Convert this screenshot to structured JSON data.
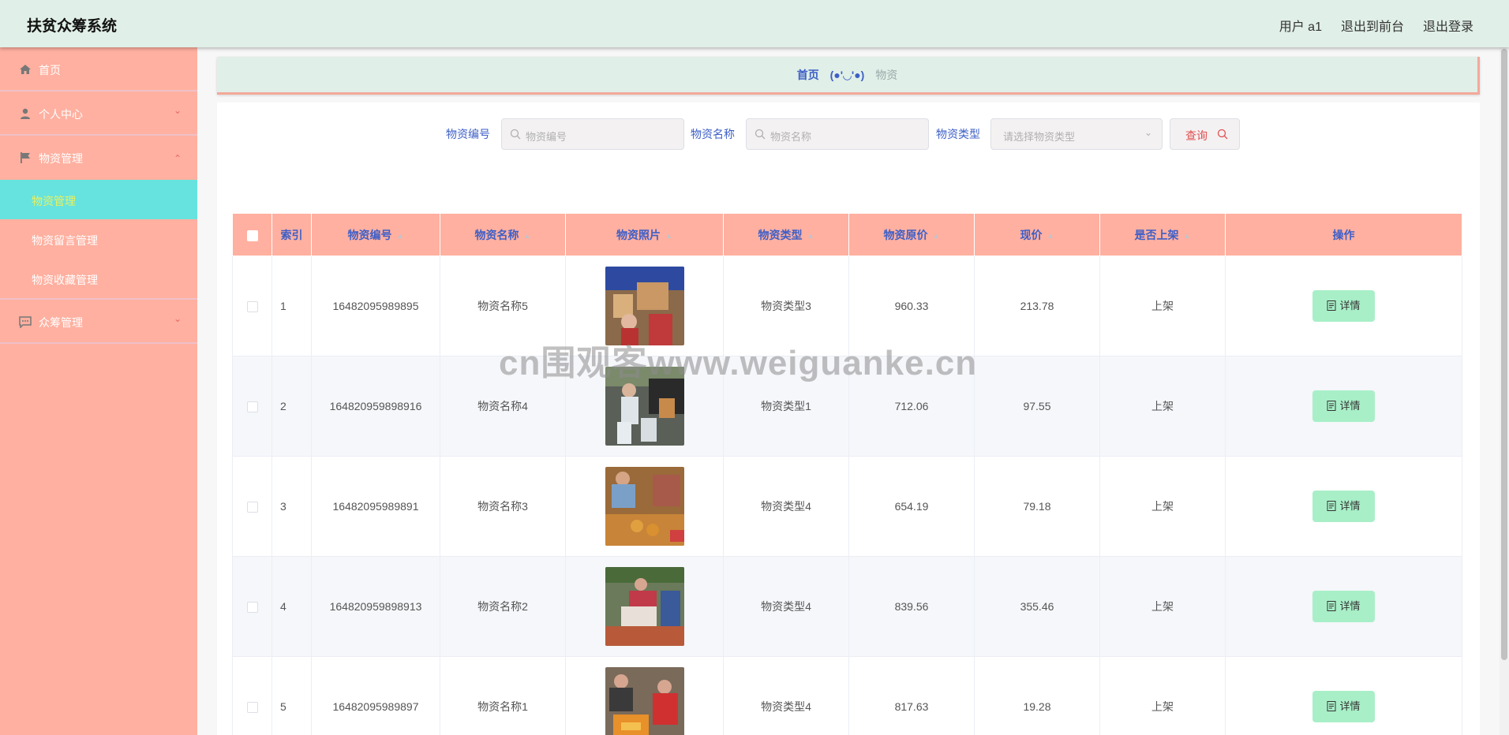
{
  "header": {
    "title": "扶贫众筹系统",
    "user": "用户 a1",
    "to_front": "退出到前台",
    "logout": "退出登录"
  },
  "sidebar": {
    "items": [
      {
        "label": "首页",
        "icon": "home-icon"
      },
      {
        "label": "个人中心",
        "icon": "user-icon",
        "arrow": "chevron-down-icon"
      },
      {
        "label": "物资管理",
        "icon": "flag-icon",
        "arrow": "chevron-up-icon",
        "children": [
          {
            "label": "物资管理",
            "active": true
          },
          {
            "label": "物资留言管理"
          },
          {
            "label": "物资收藏管理"
          }
        ]
      },
      {
        "label": "众筹管理",
        "icon": "chat-icon",
        "arrow": "chevron-down-icon"
      }
    ]
  },
  "breadcrumb": {
    "home": "首页",
    "separator": "(●'◡'●)",
    "current": "物资"
  },
  "search": {
    "code_label": "物资编号",
    "code_placeholder": "物资编号",
    "name_label": "物资名称",
    "name_placeholder": "物资名称",
    "type_label": "物资类型",
    "type_placeholder": "请选择物资类型",
    "button": "查询"
  },
  "table": {
    "headers": [
      "索引",
      "物资编号",
      "物资名称",
      "物资照片",
      "物资类型",
      "物资原价",
      "现价",
      "是否上架",
      "操作"
    ],
    "detail_label": "详情",
    "rows": [
      {
        "index": "1",
        "code": "16482095989895",
        "name": "物资名称5",
        "type": "物资类型3",
        "orig": "960.33",
        "price": "213.78",
        "status": "上架"
      },
      {
        "index": "2",
        "code": "164820959898916",
        "name": "物资名称4",
        "type": "物资类型1",
        "orig": "712.06",
        "price": "97.55",
        "status": "上架"
      },
      {
        "index": "3",
        "code": "16482095989891",
        "name": "物资名称3",
        "type": "物资类型4",
        "orig": "654.19",
        "price": "79.18",
        "status": "上架"
      },
      {
        "index": "4",
        "code": "164820959898913",
        "name": "物资名称2",
        "type": "物资类型4",
        "orig": "839.56",
        "price": "355.46",
        "status": "上架"
      },
      {
        "index": "5",
        "code": "16482095989897",
        "name": "物资名称1",
        "type": "物资类型4",
        "orig": "817.63",
        "price": "19.28",
        "status": "上架"
      }
    ]
  },
  "watermark": "cn围观客www.weiguanke.cn",
  "colors": {
    "header_bg": "#e0efe7",
    "sidebar_bg": "#ffb0a0",
    "active_menu_bg": "#66e3de",
    "table_header_bg": "#ffb0a0",
    "detail_button_bg": "#a8efc8",
    "accent_text": "#3d5fc7"
  }
}
